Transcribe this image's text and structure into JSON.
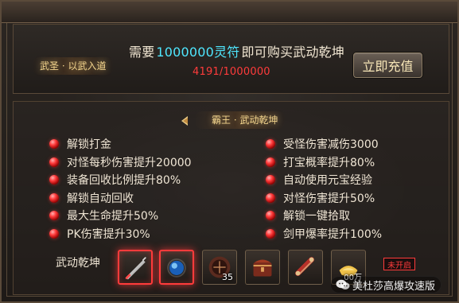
{
  "header": {
    "left_title": "武圣 · 以武入道",
    "title_prefix": "需要",
    "title_amount": "1000000灵符",
    "title_suffix": "即可购买武动乾坤",
    "progress": "4191/1000000",
    "recharge_label": "立即充值"
  },
  "section": {
    "title": "霸王 · 武动乾坤"
  },
  "benefits": {
    "left": [
      "解锁打金",
      "对怪每秒伤害提升20000",
      "装备回收比例提升80%",
      "解锁自动回收",
      "最大生命提升50%",
      "PK伤害提升30%"
    ],
    "right": [
      "受怪伤害减伤3000",
      "打宝概率提升80%",
      "自动使用元宝经验",
      "对怪伤害提升50%",
      "解锁一键拾取",
      "剑甲爆率提升100%"
    ]
  },
  "items": {
    "label": "武动乾坤",
    "slots": [
      {
        "icon": "sword-icon",
        "qty": ""
      },
      {
        "icon": "orb-icon",
        "qty": ""
      },
      {
        "icon": "plate-icon",
        "qty": "35"
      },
      {
        "icon": "treasure-chest-icon",
        "qty": ""
      },
      {
        "icon": "scroll-icon",
        "qty": ""
      },
      {
        "icon": "gold-ingot-icon",
        "qty": "00万"
      }
    ],
    "closed_badge": "未开启"
  },
  "watermark": {
    "text": "美杜莎高爆攻速版",
    "icon": "wechat-icon"
  },
  "colors": {
    "accent_cyan": "#4fe7ff",
    "warning_red": "#ff3b3b",
    "gold_text": "#f2d48d"
  }
}
